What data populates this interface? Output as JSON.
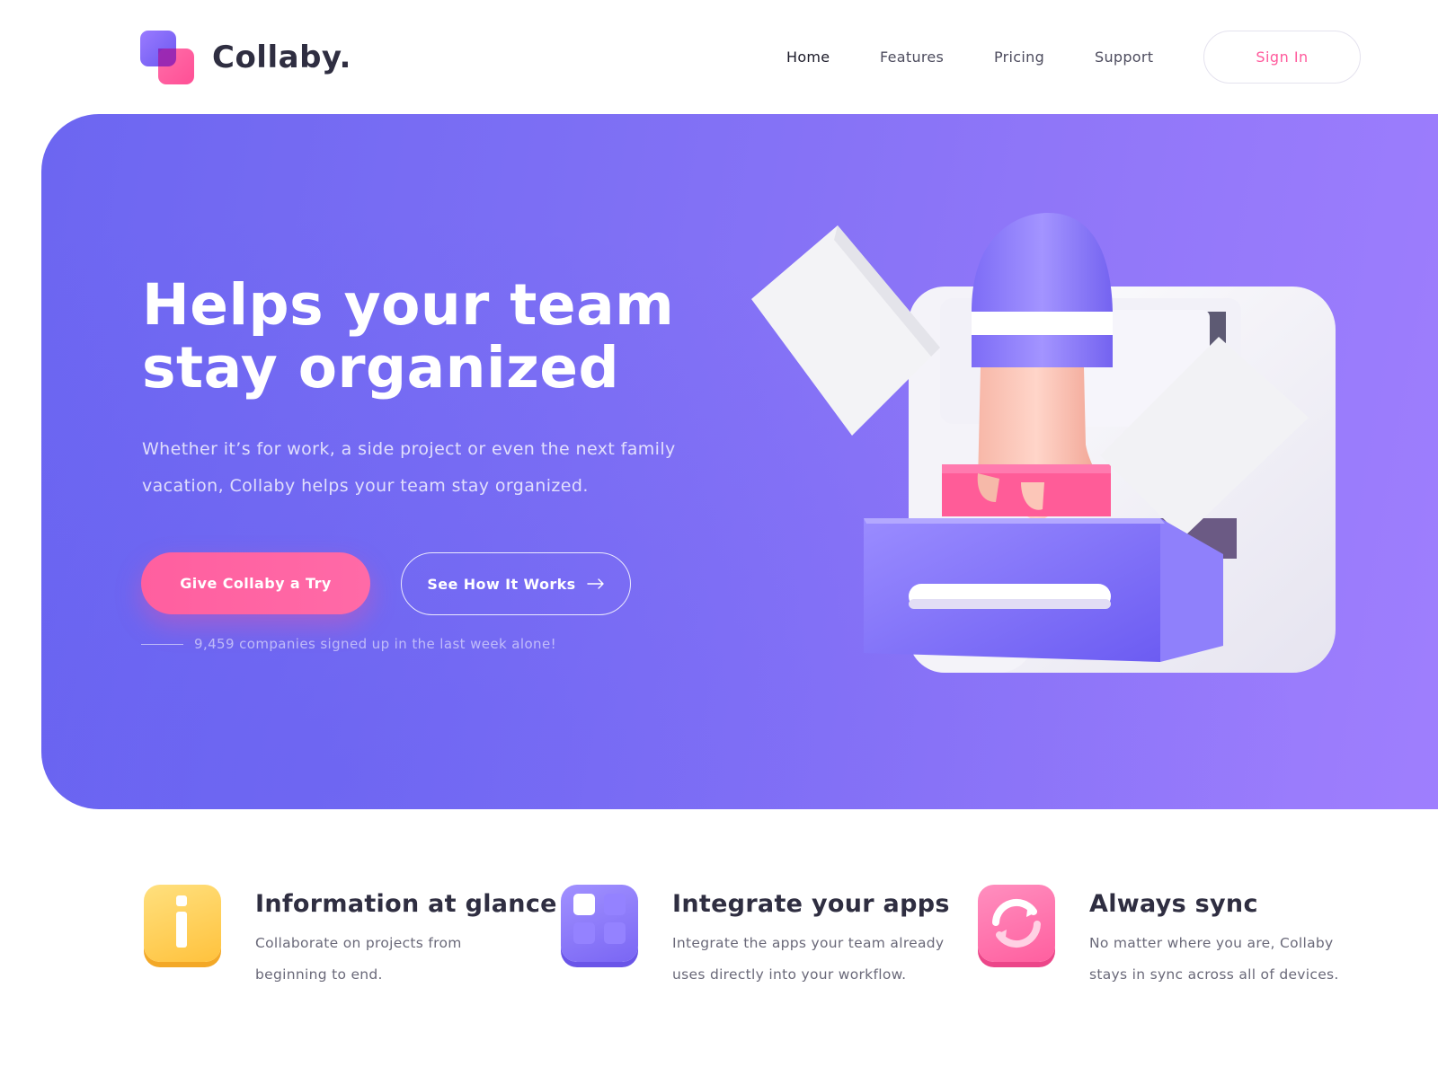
{
  "brand": {
    "name": "Collaby.",
    "colors": {
      "purple": "#7b6cf4",
      "pink": "#ff5f9f",
      "dark": "#2f2e41"
    }
  },
  "nav": {
    "items": [
      {
        "label": "Home",
        "active": true
      },
      {
        "label": "Features"
      },
      {
        "label": "Pricing"
      },
      {
        "label": "Support"
      }
    ],
    "signin_label": "Sign In"
  },
  "hero": {
    "headline_line1": "Helps your team",
    "headline_line2": "stay organized",
    "subtext": "Whether it’s for work, a side project or even the next family vacation, Collaby helps your team stay organized.",
    "primary_cta": "Give Collaby a Try",
    "secondary_cta": "See How It Works",
    "secondary_icon": "arrow-right-icon",
    "signup_note": "9,459 companies signed up in the last week alone!",
    "illustration_icon": "hand-filing-drawer-illustration"
  },
  "features": [
    {
      "icon": "info-icon",
      "title": "Information at glance",
      "desc": "Collaborate on projects from beginning to end."
    },
    {
      "icon": "apps-grid-icon",
      "title": "Integrate your apps",
      "desc": "Integrate the apps your team already uses directly into your workflow."
    },
    {
      "icon": "sync-icon",
      "title": "Always sync",
      "desc": "No matter where you are, Collaby stays in sync across all of devices."
    }
  ]
}
